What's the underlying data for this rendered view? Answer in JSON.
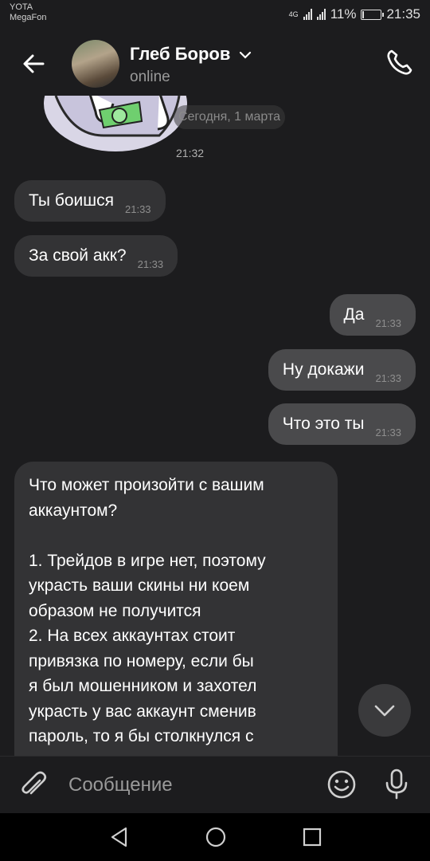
{
  "status_bar": {
    "carrier1": "YOTA",
    "carrier2": "MegaFon",
    "network": "4G",
    "battery_percent": "11%",
    "battery_level": 0.11,
    "time": "21:35"
  },
  "header": {
    "name": "Глеб Боров",
    "status": "online"
  },
  "chat": {
    "date_divider": "Сегодня, 1 марта",
    "sticker_time": "21:32",
    "messages": [
      {
        "dir": "in",
        "text": "Ты боишся",
        "time": "21:33"
      },
      {
        "dir": "in",
        "text": "За свой акк?",
        "time": "21:33"
      },
      {
        "dir": "out",
        "text": "Да",
        "time": "21:33"
      },
      {
        "dir": "out",
        "text": "Ну докажи",
        "time": "21:33"
      },
      {
        "dir": "out",
        "text": "Что это ты",
        "time": "21:33"
      }
    ],
    "long_message": {
      "line1": "Что может произойти с вашим",
      "line2": "аккаунтом?",
      "line3": "1. Трейдов в игре нет, поэтому",
      "line4": "украсть ваши скины ни коем",
      "line5": "образом не получится",
      "line6": "2. На всех аккаунтах стоит",
      "line7": "привязка по номеру, если бы",
      "line8": "я был мошенником и захотел",
      "line9": "украсть у вас аккаунт сменив",
      "line10": "пароль, то я бы столкнулся с"
    }
  },
  "composer": {
    "placeholder": "Сообщение"
  },
  "colors": {
    "background": "#1c1c1e",
    "bubble_in": "#333335",
    "bubble_out": "#4a4a4c",
    "time_text": "#8e8e8e"
  },
  "icons": [
    "back-arrow-icon",
    "chevron-down-icon",
    "phone-icon",
    "paperclip-icon",
    "emoji-icon",
    "microphone-icon",
    "scroll-down-icon",
    "nav-back-icon",
    "nav-home-icon",
    "nav-recent-icon"
  ]
}
